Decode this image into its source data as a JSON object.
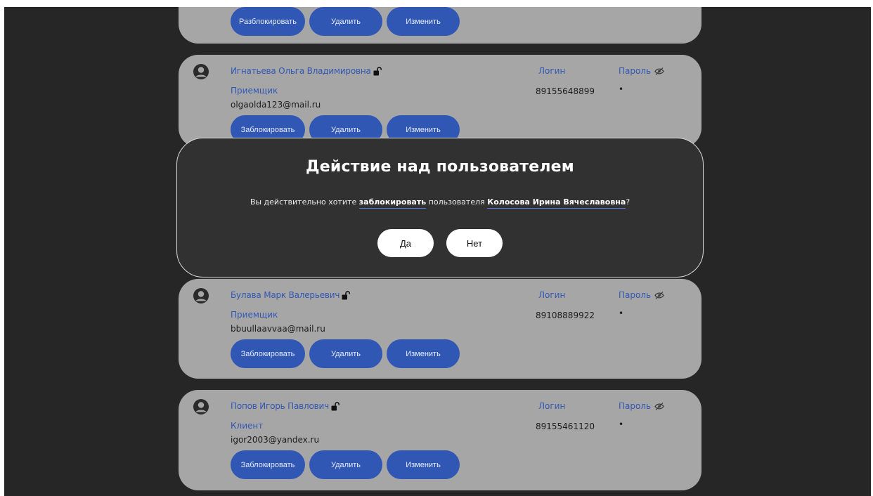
{
  "top_card": {
    "buttons": [
      "Разблокировать",
      "Удалить",
      "Изменить"
    ]
  },
  "users": [
    {
      "name": "Игнатьева Ольга Владимировна",
      "role": "Приемщик",
      "email": "olgaolda123@mail.ru",
      "login_label": "Логин",
      "login": "89155648899",
      "password_label": "Пароль",
      "password": "•",
      "buttons": [
        "Заблокировать",
        "Удалить",
        "Изменить"
      ]
    },
    {
      "name": "Булава Марк Валерьевич",
      "role": "Приемщик",
      "email": "bbuullaavvaa@mail.ru",
      "login_label": "Логин",
      "login": "89108889922",
      "password_label": "Пароль",
      "password": "•",
      "buttons": [
        "Заблокировать",
        "Удалить",
        "Изменить"
      ]
    },
    {
      "name": "Попов Игорь Павлович",
      "role": "Клиент",
      "email": "igor2003@yandex.ru",
      "login_label": "Логин",
      "login": "89155461120",
      "password_label": "Пароль",
      "password": "•",
      "buttons": [
        "Заблокировать",
        "Удалить",
        "Изменить"
      ]
    }
  ],
  "modal": {
    "title": "Действие над пользователем",
    "text_before": "Вы действительно хотите ",
    "action": "заблокировать",
    "text_middle": " пользователя ",
    "user": "Колосова Ирина Вячеславовна",
    "text_end": "?",
    "yes_label": "Да",
    "no_label": "Нет"
  },
  "colors": {
    "background": "#262626",
    "card": "#a6a6a6",
    "accent": "#3157b5",
    "modal": "#313131"
  },
  "icons": [
    "user-avatar-icon",
    "unlock-icon",
    "eye-off-icon"
  ]
}
